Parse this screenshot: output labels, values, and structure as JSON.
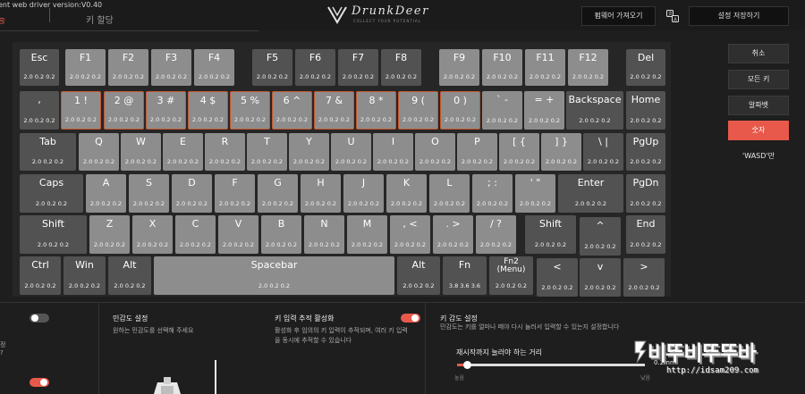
{
  "header": {
    "version_text": "ent web driver version:V0.40",
    "tab_active": "능",
    "tab_other": "키 할당",
    "logo_text": "DrunkDeer",
    "logo_subtitle": "COLLECT YOUR POTENTIAL",
    "firmware_button": "펌웨어 가져오기",
    "language_icon": "translate-icon",
    "save_button": "설정 저장하기"
  },
  "keyboard": {
    "keys": [
      {
        "id": "esc",
        "label": "Esc",
        "values": "2.0  0.2  0.2",
        "light": false,
        "selected": false
      },
      {
        "id": "f1",
        "label": "F1",
        "values": "2.0  0.2  0.2",
        "light": true,
        "selected": false
      },
      {
        "id": "f2",
        "label": "F2",
        "values": "2.0  0.2  0.2",
        "light": true,
        "selected": false
      },
      {
        "id": "f3",
        "label": "F3",
        "values": "2.0  0.2  0.2",
        "light": true,
        "selected": false
      },
      {
        "id": "f4",
        "label": "F4",
        "values": "2.0  0.2  0.2",
        "light": true,
        "selected": false
      },
      {
        "id": "f5",
        "label": "F5",
        "values": "2.0  0.2  0.2",
        "light": false,
        "selected": false
      },
      {
        "id": "f6",
        "label": "F6",
        "values": "2.0  0.2  0.2",
        "light": false,
        "selected": false
      },
      {
        "id": "f7",
        "label": "F7",
        "values": "2.0  0.2  0.2",
        "light": false,
        "selected": false
      },
      {
        "id": "f8",
        "label": "F8",
        "values": "2.0  0.2  0.2",
        "light": false,
        "selected": false
      },
      {
        "id": "f9",
        "label": "F9",
        "values": "2.0  0.2  0.2",
        "light": true,
        "selected": false
      },
      {
        "id": "f10",
        "label": "F10",
        "values": "2.0  0.2  0.2",
        "light": true,
        "selected": false
      },
      {
        "id": "f11",
        "label": "F11",
        "values": "2.0  0.2  0.2",
        "light": true,
        "selected": false
      },
      {
        "id": "f12",
        "label": "F12",
        "values": "2.0  0.2  0.2",
        "light": true,
        "selected": false
      },
      {
        "id": "del",
        "label": "Del",
        "values": "2.0  0.2  0.2",
        "light": false,
        "selected": false
      },
      {
        "id": "grave",
        "label": ",",
        "values": "2.0  0.2  0.2",
        "light": false,
        "selected": false
      },
      {
        "id": "d1",
        "label": "1 !",
        "values": "2.0  0.2  0.2",
        "light": true,
        "selected": true
      },
      {
        "id": "d2",
        "label": "2 @",
        "values": "2.0  0.2  0.2",
        "light": true,
        "selected": true
      },
      {
        "id": "d3",
        "label": "3 #",
        "values": "2.0  0.2  0.2",
        "light": true,
        "selected": true
      },
      {
        "id": "d4",
        "label": "4 $",
        "values": "2.0  0.2  0.2",
        "light": true,
        "selected": true
      },
      {
        "id": "d5",
        "label": "5 %",
        "values": "2.0  0.2  0.2",
        "light": true,
        "selected": true
      },
      {
        "id": "d6",
        "label": "6 ^",
        "values": "2.0  0.2  0.2",
        "light": true,
        "selected": true
      },
      {
        "id": "d7",
        "label": "7 &",
        "values": "2.0  0.2  0.2",
        "light": true,
        "selected": true
      },
      {
        "id": "d8",
        "label": "8 *",
        "values": "2.0  0.2  0.2",
        "light": true,
        "selected": true
      },
      {
        "id": "d9",
        "label": "9 (",
        "values": "2.0  0.2  0.2",
        "light": true,
        "selected": true
      },
      {
        "id": "d0",
        "label": "0 )",
        "values": "2.0  0.2  0.2",
        "light": true,
        "selected": true
      },
      {
        "id": "minus",
        "label": "` -",
        "values": "2.0  0.2  0.2",
        "light": true,
        "selected": false
      },
      {
        "id": "equal",
        "label": "= +",
        "values": "2.0  0.2  0.2",
        "light": true,
        "selected": false
      },
      {
        "id": "backspace",
        "label": "Backspace",
        "values": "2.0  0.2  0.2",
        "light": false,
        "selected": false
      },
      {
        "id": "home",
        "label": "Home",
        "values": "2.0  0.2  0.2",
        "light": false,
        "selected": false
      },
      {
        "id": "tab",
        "label": "Tab",
        "values": "2.0  0.2  0.2",
        "light": false,
        "selected": false
      },
      {
        "id": "q",
        "label": "Q",
        "values": "2.0  0.2  0.2",
        "light": true,
        "selected": false
      },
      {
        "id": "w",
        "label": "W",
        "values": "2.0  0.2  0.2",
        "light": true,
        "selected": false
      },
      {
        "id": "e",
        "label": "E",
        "values": "2.0  0.2  0.2",
        "light": true,
        "selected": false
      },
      {
        "id": "r",
        "label": "R",
        "values": "2.0  0.2  0.2",
        "light": true,
        "selected": false
      },
      {
        "id": "t",
        "label": "T",
        "values": "2.0  0.2  0.2",
        "light": true,
        "selected": false
      },
      {
        "id": "y",
        "label": "Y",
        "values": "2.0  0.2  0.2",
        "light": true,
        "selected": false
      },
      {
        "id": "u",
        "label": "U",
        "values": "2.0  0.2  0.2",
        "light": true,
        "selected": false
      },
      {
        "id": "i",
        "label": "I",
        "values": "2.0  0.2  0.2",
        "light": true,
        "selected": false
      },
      {
        "id": "o",
        "label": "O",
        "values": "2.0  0.2  0.2",
        "light": true,
        "selected": false
      },
      {
        "id": "p",
        "label": "P",
        "values": "2.0  0.2  0.2",
        "light": true,
        "selected": false
      },
      {
        "id": "lbracket",
        "label": "[ {",
        "values": "2.0  0.2  0.2",
        "light": true,
        "selected": false
      },
      {
        "id": "rbracket",
        "label": "] }",
        "values": "2.0  0.2  0.2",
        "light": true,
        "selected": false
      },
      {
        "id": "backslash",
        "label": "\\ |",
        "values": "2.0  0.2  0.2",
        "light": false,
        "selected": false
      },
      {
        "id": "pgup",
        "label": "PgUp",
        "values": "2.0  0.2  0.2",
        "light": false,
        "selected": false
      },
      {
        "id": "caps",
        "label": "Caps",
        "values": "2.0  0.2  0.2",
        "light": false,
        "selected": false
      },
      {
        "id": "a",
        "label": "A",
        "values": "2.0  0.2  0.2",
        "light": true,
        "selected": false
      },
      {
        "id": "s",
        "label": "S",
        "values": "2.0  0.2  0.2",
        "light": true,
        "selected": false
      },
      {
        "id": "d",
        "label": "D",
        "values": "2.0  0.2  0.2",
        "light": true,
        "selected": false
      },
      {
        "id": "f",
        "label": "F",
        "values": "2.0  0.2  0.2",
        "light": true,
        "selected": false
      },
      {
        "id": "g",
        "label": "G",
        "values": "2.0  0.2  0.2",
        "light": true,
        "selected": false
      },
      {
        "id": "h",
        "label": "H",
        "values": "2.0  0.2  0.2",
        "light": true,
        "selected": false
      },
      {
        "id": "j",
        "label": "J",
        "values": "2.0  0.2  0.2",
        "light": true,
        "selected": false
      },
      {
        "id": "k",
        "label": "K",
        "values": "2.0  0.2  0.2",
        "light": true,
        "selected": false
      },
      {
        "id": "l",
        "label": "L",
        "values": "2.0  0.2  0.2",
        "light": true,
        "selected": false
      },
      {
        "id": "semicolon",
        "label": "; :",
        "values": "2.0  0.2  0.2",
        "light": true,
        "selected": false
      },
      {
        "id": "quote",
        "label": "' \"",
        "values": "2.0  0.2  0.2",
        "light": true,
        "selected": false
      },
      {
        "id": "enter",
        "label": "Enter",
        "values": "2.0  0.2  0.2",
        "light": false,
        "selected": false
      },
      {
        "id": "pgdn",
        "label": "PgDn",
        "values": "2.0  0.2  0.2",
        "light": false,
        "selected": false
      },
      {
        "id": "lshift",
        "label": "Shift",
        "values": "2.0  0.2  0.2",
        "light": false,
        "selected": false
      },
      {
        "id": "z",
        "label": "Z",
        "values": "2.0  0.2  0.2",
        "light": true,
        "selected": false
      },
      {
        "id": "x",
        "label": "X",
        "values": "2.0  0.2  0.2",
        "light": true,
        "selected": false
      },
      {
        "id": "c",
        "label": "C",
        "values": "2.0  0.2  0.2",
        "light": true,
        "selected": false
      },
      {
        "id": "v",
        "label": "V",
        "values": "2.0  0.2  0.2",
        "light": true,
        "selected": false
      },
      {
        "id": "b",
        "label": "B",
        "values": "2.0  0.2  0.2",
        "light": true,
        "selected": false
      },
      {
        "id": "n",
        "label": "N",
        "values": "2.0  0.2  0.2",
        "light": true,
        "selected": false
      },
      {
        "id": "m",
        "label": "M",
        "values": "2.0  0.2  0.2",
        "light": true,
        "selected": false
      },
      {
        "id": "comma",
        "label": ", <",
        "values": "2.0  0.2  0.2",
        "light": true,
        "selected": false
      },
      {
        "id": "period",
        "label": ". >",
        "values": "2.0  0.2  0.2",
        "light": true,
        "selected": false
      },
      {
        "id": "slash",
        "label": "/ ?",
        "values": "2.0  0.2  0.2",
        "light": true,
        "selected": false
      },
      {
        "id": "rshift",
        "label": "Shift",
        "values": "2.0  0.2  0.2",
        "light": false,
        "selected": false
      },
      {
        "id": "up",
        "label": "^",
        "values": "2.0  0.2  0.2",
        "light": false,
        "selected": false
      },
      {
        "id": "end",
        "label": "End",
        "values": "2.0  0.2  0.2",
        "light": false,
        "selected": false
      },
      {
        "id": "lctrl",
        "label": "Ctrl",
        "values": "2.0  0.2  0.2",
        "light": false,
        "selected": false
      },
      {
        "id": "lwin",
        "label": "Win",
        "values": "2.0  0.2  0.2",
        "light": false,
        "selected": false
      },
      {
        "id": "lalt",
        "label": "Alt",
        "values": "2.0  0.2  0.2",
        "light": false,
        "selected": false
      },
      {
        "id": "space",
        "label": "Spacebar",
        "values": "2.0  0.2  0.2",
        "light": true,
        "selected": false
      },
      {
        "id": "ralt",
        "label": "Alt",
        "values": "2.0  0.2  0.2",
        "light": false,
        "selected": false
      },
      {
        "id": "fn",
        "label": "Fn",
        "values": "3.8  3.6  3.6",
        "light": false,
        "selected": false
      },
      {
        "id": "fn2",
        "label": "Fn2\n(Menu)",
        "values": "2.0  0.2  0.2",
        "light": false,
        "selected": false
      },
      {
        "id": "left",
        "label": "<",
        "values": "2.0  0.2  0.2",
        "light": false,
        "selected": false
      },
      {
        "id": "down",
        "label": "v",
        "values": "2.0  0.2  0.2",
        "light": false,
        "selected": false
      },
      {
        "id": "right",
        "label": ">",
        "values": "2.0  0.2  0.2",
        "light": false,
        "selected": false
      }
    ]
  },
  "sidebar": {
    "items": [
      {
        "label": "취소",
        "active": false,
        "plain": false
      },
      {
        "label": "모든 키",
        "active": false,
        "plain": false
      },
      {
        "label": "알파벳",
        "active": false,
        "plain": false
      },
      {
        "label": "숫자",
        "active": true,
        "plain": false
      },
      {
        "label": "'WASD'만",
        "active": false,
        "plain": true
      }
    ]
  },
  "bottom": {
    "left_cut_1": "정",
    "left_cut_2": "?",
    "sensitivity_title": "민감도 설정",
    "sensitivity_desc": "원하는 민감도를 선택해 주세요",
    "tracking_title": "키 입력 추적 활성화",
    "tracking_desc_1": "활성화 후 임의의 키 입력이 추적되며, 여러 키 입력",
    "tracking_desc_2": "을 동시에 추적할 수 있습니다",
    "key_sens_title": "키 감도 설정",
    "key_sens_desc": "민감도는 키를 얼마나 떼야 다시 눌러서 입력할 수 있는지 설정합니다",
    "slider_title": "재시작까지 눌러야 하는 거리",
    "slider_value": "0.2mm",
    "slider_min": "높음",
    "slider_max": "낮음",
    "slider_fraction": 0.05,
    "toggles": {
      "left_top": false,
      "left_bottom": true,
      "tracking": true
    }
  },
  "watermark": {
    "text": "비뚜비뚜뚜바",
    "url": "http://idsam209.com"
  },
  "colors": {
    "accent": "#e8594b",
    "key_dark": "#525252",
    "key_light": "#8d8d8d",
    "selected_border": "#c4582f",
    "background": "#1e1e1e"
  }
}
